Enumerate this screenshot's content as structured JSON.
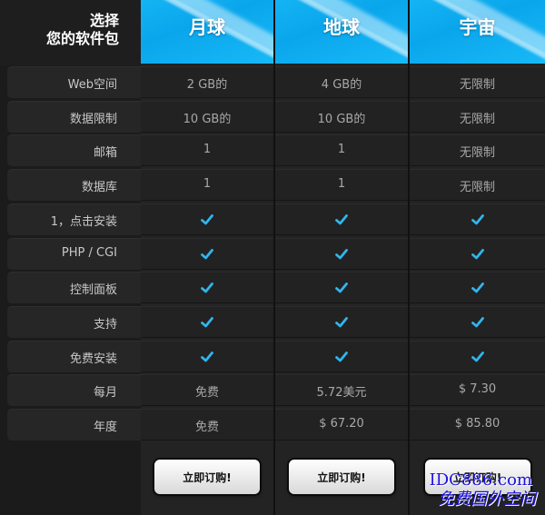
{
  "header": {
    "title_line1": "选择",
    "title_line2": "您的软件包",
    "plans": [
      "月球",
      "地球",
      "宇宙"
    ]
  },
  "rows": [
    {
      "label": "Web空间",
      "values": [
        "2 GB的",
        "4 GB的",
        "无限制"
      ]
    },
    {
      "label": "数据限制",
      "values": [
        "10 GB的",
        "10 GB的",
        "无限制"
      ]
    },
    {
      "label": "邮箱",
      "values": [
        "1",
        "1",
        "无限制"
      ]
    },
    {
      "label": "数据库",
      "values": [
        "1",
        "1",
        "无限制"
      ]
    },
    {
      "label": "1，点击安装",
      "values": [
        "check",
        "check",
        "check"
      ]
    },
    {
      "label": "PHP / CGI",
      "values": [
        "check",
        "check",
        "check"
      ]
    },
    {
      "label": "控制面板",
      "values": [
        "check",
        "check",
        "check"
      ]
    },
    {
      "label": "支持",
      "values": [
        "check",
        "check",
        "check"
      ]
    },
    {
      "label": "免费安装",
      "values": [
        "check",
        "check",
        "check"
      ]
    },
    {
      "label": "每月",
      "values": [
        "免费",
        "5.72美元",
        "$ 7.30"
      ]
    },
    {
      "label": "年度",
      "values": [
        "免费",
        "$ 67.20",
        "$ 85.80"
      ]
    }
  ],
  "buttons": [
    "立即订购!",
    "立即订购!",
    "立即订购!"
  ],
  "watermark": {
    "line1": "IDC886.com",
    "line2": "免费国外空间"
  },
  "colors": {
    "accent": "#14b4f4",
    "check": "#2fb6ee"
  }
}
